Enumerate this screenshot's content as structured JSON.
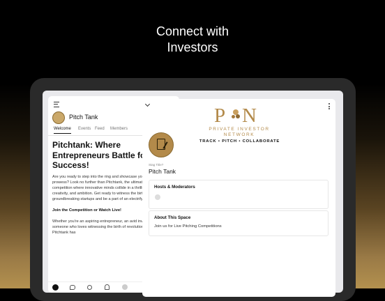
{
  "headline": {
    "line1": "Connect with",
    "line2": "Investors"
  },
  "left_panel": {
    "title": "Pitch Tank",
    "tabs": [
      {
        "label": "Welcome",
        "active": true
      },
      {
        "label": "Events",
        "active": false
      },
      {
        "label": "Feed",
        "active": false
      },
      {
        "label": "Members",
        "active": false
      }
    ],
    "article": {
      "heading": "Pitchtank: Where Entrepreneurs Battle for Success!",
      "paragraph1": "Are you ready to step into the ring and showcase your entrepreneurial prowess? Look no further than Pitchtank, the ultimate live pitching competition where innovative minds collide in a thrilling battle of ideas, creativity, and ambition. Get ready to witness the birth of groundbreaking startups and be a part of an electrifying community!",
      "subheading": "Join the Competition or Watch Live!",
      "paragraph2": "Whether you're an aspiring entrepreneur, an avid investor, or simply someone who loves witnessing the birth of revolutionary ideas, Pitchtank has"
    },
    "bottom_nav": [
      "home-icon",
      "chat-icon",
      "search-icon",
      "bell-icon",
      "avatar"
    ]
  },
  "right_panel": {
    "brand": {
      "letter_p": "P",
      "letter_n": "N",
      "name_line1": "PRIVATE INVESTOR",
      "name_line2": "NETWORK",
      "tagline": "TRACK • PITCH • COLLABORATE"
    },
    "space_label": "Stag Title?",
    "space_title": "Pitch Tank",
    "hosts": {
      "heading": "Hosts & Moderators"
    },
    "about": {
      "heading": "About This Space",
      "text": "Join us for Live Pitching Competitions"
    }
  },
  "colors": {
    "gold": "#b38a4a",
    "background_bottom": "#b3914f"
  }
}
